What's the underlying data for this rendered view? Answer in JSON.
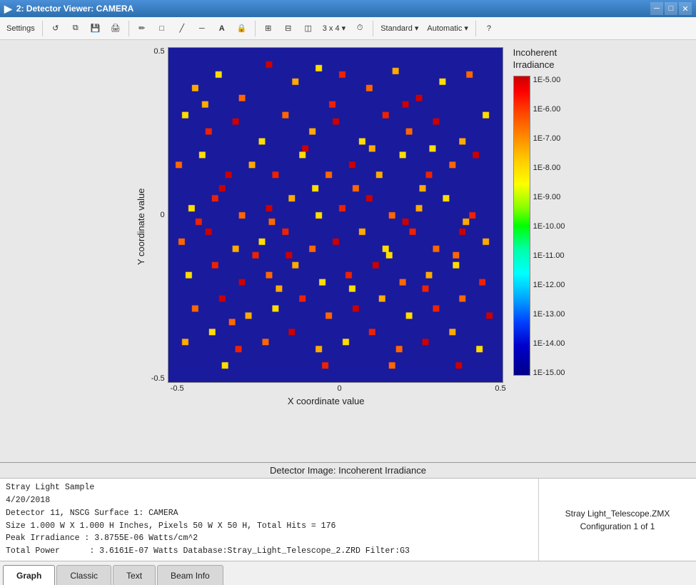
{
  "titlebar": {
    "title": "2: Detector Viewer: CAMERA",
    "controls": [
      "minimize",
      "maximize",
      "close"
    ]
  },
  "toolbar": {
    "settings_label": "Settings",
    "grid_label": "3 x 4 ▾",
    "standard_label": "Standard ▾",
    "automatic_label": "Automatic ▾"
  },
  "plot": {
    "title": "Incoherent\nIrradiance",
    "y_axis_label": "Y coordinate value",
    "x_axis_label": "X coordinate value",
    "y_ticks": [
      "0.5",
      "",
      "0",
      "",
      "-0.5"
    ],
    "x_ticks": [
      "-0.5",
      "0",
      "0.5"
    ],
    "colorbar_labels": [
      "1E-5.00",
      "1E-6.00",
      "1E-7.00",
      "1E-8.00",
      "1E-9.00",
      "1E-10.00",
      "1E-11.00",
      "1E-12.00",
      "1E-13.00",
      "1E-14.00",
      "1E-15.00"
    ]
  },
  "info": {
    "header": "Detector Image: Incoherent Irradiance",
    "lines": [
      "Stray Light Sample",
      "4/20/2018",
      "Detector 11, NSCG Surface 1: CAMERA",
      "Size 1.000 W X 1.000 H Inches, Pixels 50 W X 50 H, Total Hits = 176",
      "Peak Irradiance : 3.8755E-06 Watts/cm^2",
      "Total Power     : 3.6161E-07 Watts Database:Stray_Light_Telescope_2.ZRD Filter:G3"
    ],
    "right_text": "Stray Light_Telescope.ZMX\nConfiguration 1 of 1"
  },
  "tabs": [
    {
      "label": "Graph",
      "active": true
    },
    {
      "label": "Classic",
      "active": false
    },
    {
      "label": "Text",
      "active": false
    },
    {
      "label": "Beam Info",
      "active": false
    }
  ]
}
